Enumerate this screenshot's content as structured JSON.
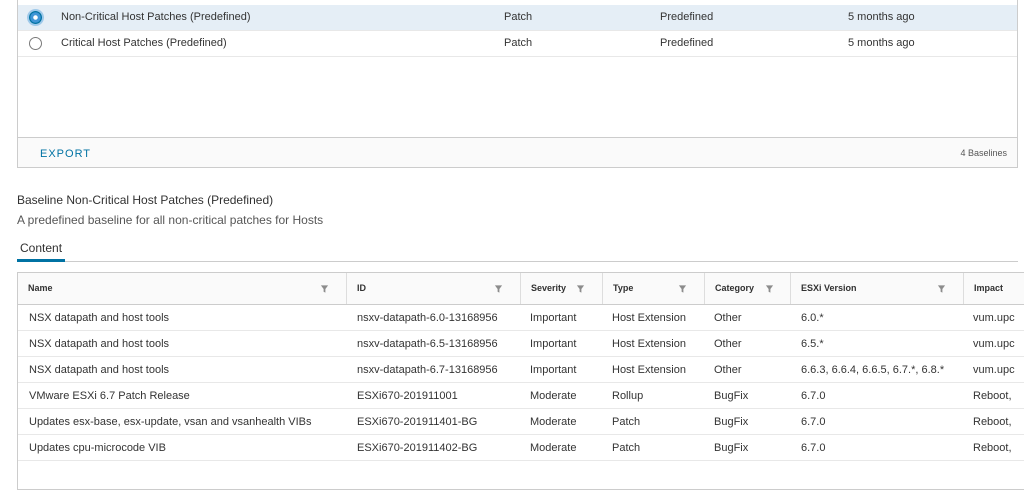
{
  "baselines_list": {
    "rows": [
      {
        "name": "Non-Critical Host Patches (Predefined)",
        "content": "Patch",
        "type": "Predefined",
        "last_modified": "5 months ago",
        "selected": true
      },
      {
        "name": "Critical Host Patches (Predefined)",
        "content": "Patch",
        "type": "Predefined",
        "last_modified": "5 months ago",
        "selected": false
      }
    ],
    "export_label": "EXPORT",
    "count_label": "4 Baselines"
  },
  "details": {
    "title": "Baseline Non-Critical Host Patches (Predefined)",
    "description": "A predefined baseline for all non-critical patches for Hosts",
    "tab_label": "Content"
  },
  "content_table": {
    "columns": [
      "Name",
      "ID",
      "Severity",
      "Type",
      "Category",
      "ESXi Version",
      "Impact"
    ],
    "rows": [
      {
        "name": "NSX datapath and host tools",
        "id": "nsxv-datapath-6.0-13168956",
        "severity": "Important",
        "type": "Host Extension",
        "category": "Other",
        "esxi_version": "6.0.*",
        "impact": "vum.upc"
      },
      {
        "name": "NSX datapath and host tools",
        "id": "nsxv-datapath-6.5-13168956",
        "severity": "Important",
        "type": "Host Extension",
        "category": "Other",
        "esxi_version": "6.5.*",
        "impact": "vum.upc"
      },
      {
        "name": "NSX datapath and host tools",
        "id": "nsxv-datapath-6.7-13168956",
        "severity": "Important",
        "type": "Host Extension",
        "category": "Other",
        "esxi_version": "6.6.3, 6.6.4, 6.6.5, 6.7.*, 6.8.*",
        "impact": "vum.upc"
      },
      {
        "name": "VMware ESXi 6.7 Patch Release",
        "id": "ESXi670-201911001",
        "severity": "Moderate",
        "type": "Rollup",
        "category": "BugFix",
        "esxi_version": "6.7.0",
        "impact": "Reboot,"
      },
      {
        "name": "Updates esx-base, esx-update, vsan and vsanhealth VIBs",
        "id": "ESXi670-201911401-BG",
        "severity": "Moderate",
        "type": "Patch",
        "category": "BugFix",
        "esxi_version": "6.7.0",
        "impact": "Reboot,"
      },
      {
        "name": "Updates cpu-microcode VIB",
        "id": "ESXi670-201911402-BG",
        "severity": "Moderate",
        "type": "Patch",
        "category": "BugFix",
        "esxi_version": "6.7.0",
        "impact": "Reboot,"
      }
    ]
  },
  "colors": {
    "accent": "#0072a3",
    "selected_row": "#e5eef6",
    "border": "#cccccc"
  }
}
